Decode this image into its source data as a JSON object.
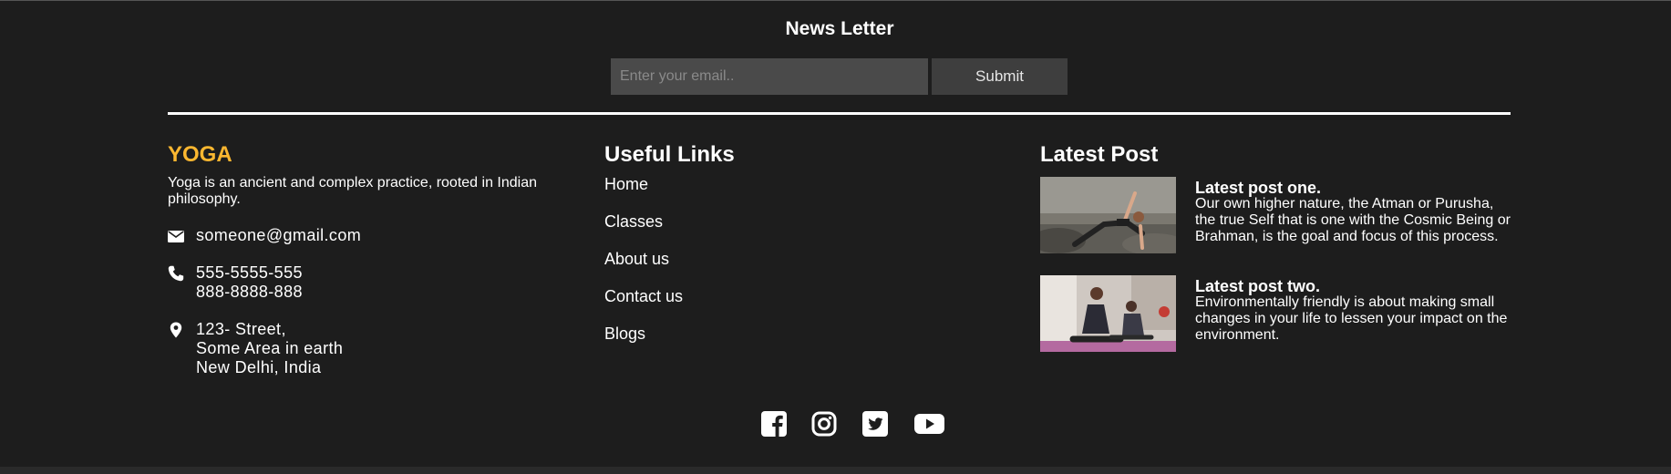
{
  "newsletter": {
    "title": "News Letter",
    "email_placeholder": "Enter your email..",
    "submit_label": "Submit"
  },
  "brand": {
    "name": "YOGA",
    "color": "#fbb730",
    "description": "Yoga is an ancient and complex practice, rooted in Indian philosophy."
  },
  "contact": {
    "email": "someone@gmail.com",
    "phone_1": "555-5555-555",
    "phone_2": "888-8888-888",
    "address_1": "123- Street,",
    "address_2": "Some Area in earth",
    "address_3": "New Delhi, India"
  },
  "useful_links": {
    "title": "Useful Links",
    "items": [
      {
        "label": "Home"
      },
      {
        "label": "Classes"
      },
      {
        "label": "About us"
      },
      {
        "label": "Contact us"
      },
      {
        "label": "Blogs"
      }
    ]
  },
  "latest_post": {
    "title": "Latest Post",
    "posts": [
      {
        "title": "Latest post one.",
        "text": "Our own higher nature, the Atman or Purusha, the true Self that is one with the Cosmic Being or Brahman, is the goal and focus of this process.",
        "image": "yoga-pose-outdoor-photo"
      },
      {
        "title": "Latest post two.",
        "text": "Environmentally friendly is about making small changes in your life to lessen your impact on the environment.",
        "image": "yoga-class-indoor-photo"
      }
    ]
  },
  "social": [
    "facebook-icon",
    "instagram-icon",
    "twitter-icon",
    "youtube-icon"
  ]
}
